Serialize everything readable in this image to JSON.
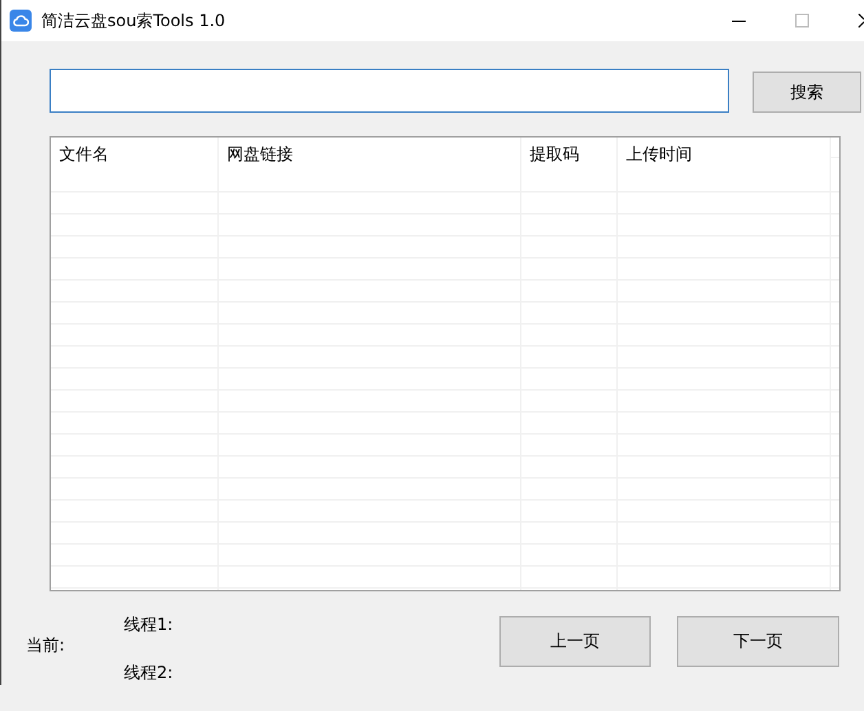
{
  "window": {
    "title": "简洁云盘sou索Tools 1.0"
  },
  "search": {
    "button": "搜索"
  },
  "table": {
    "columns": [
      "文件名",
      "网盘链接",
      "提取码",
      "上传时间"
    ]
  },
  "status": {
    "current": "当前:",
    "threads": [
      "线程1:",
      "线程2:"
    ]
  },
  "buttons": [
    "上一页",
    "下一页"
  ]
}
